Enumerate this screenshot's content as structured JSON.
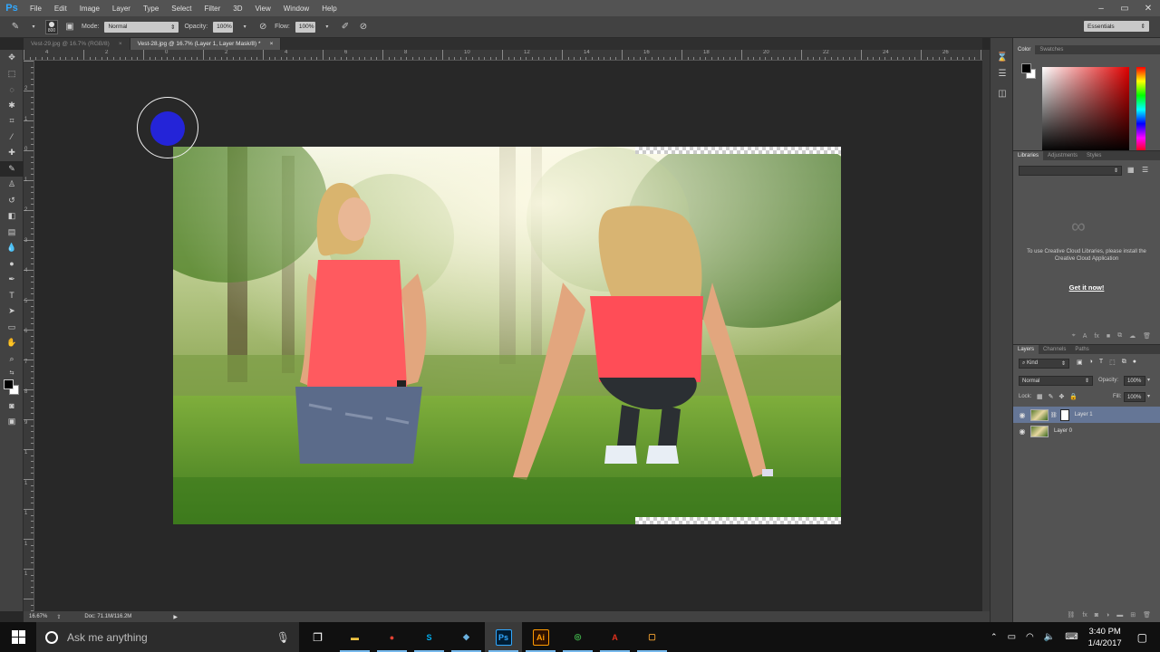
{
  "app": {
    "logo": "Ps"
  },
  "menu": [
    "File",
    "Edit",
    "Image",
    "Layer",
    "Type",
    "Select",
    "Filter",
    "3D",
    "View",
    "Window",
    "Help"
  ],
  "options": {
    "brush_size": "800",
    "mode_label": "Mode:",
    "mode_value": "Normal",
    "opacity_label": "Opacity:",
    "opacity_value": "100%",
    "flow_label": "Flow:",
    "flow_value": "100%",
    "workspace": "Essentials"
  },
  "tabs": [
    {
      "label": "Vest-29.jpg @ 16.7% (RGB/8)",
      "active": false
    },
    {
      "label": "Vest-28.jpg @ 16.7% (Layer 1, Layer Mask/8) *",
      "active": true
    }
  ],
  "ruler": {
    "top_labels": [
      "4",
      "2",
      "0",
      "2",
      "4",
      "6",
      "8",
      "10",
      "12",
      "14",
      "16",
      "18",
      "20",
      "22",
      "24",
      "26"
    ],
    "left_labels": [
      "2",
      "1",
      "0",
      "1",
      "2",
      "3",
      "4",
      "5",
      "6",
      "7",
      "8",
      "9",
      "1",
      "1",
      "1",
      "1",
      "1"
    ]
  },
  "status": {
    "zoom": "16.67%",
    "doc": "Doc: 71.1M/116.2M"
  },
  "color_panel": {
    "tabs": [
      "Color",
      "Swatches"
    ],
    "foreground": "#000000",
    "background": "#ffffff"
  },
  "libraries_panel": {
    "tabs": [
      "Libraries",
      "Adjustments",
      "Styles"
    ],
    "message": "To use Creative Cloud Libraries, please install the Creative Cloud Application",
    "link": "Get it now!"
  },
  "layers_panel": {
    "tabs": [
      "Layers",
      "Channels",
      "Paths"
    ],
    "filter": "Kind",
    "blend_mode": "Normal",
    "opacity_label": "Opacity:",
    "opacity_value": "100%",
    "lock_label": "Lock:",
    "fill_label": "Fill:",
    "fill_value": "100%",
    "layers": [
      {
        "name": "Layer 1",
        "selected": true,
        "has_mask": true
      },
      {
        "name": "Layer 0",
        "selected": false,
        "has_mask": false
      }
    ]
  },
  "taskbar": {
    "search_placeholder": "Ask me anything",
    "time": "3:40 PM",
    "date": "1/4/2017",
    "apps": [
      {
        "name": "File Explorer",
        "glyph": "▬",
        "color": "#f4c542"
      },
      {
        "name": "Chrome",
        "glyph": "●",
        "color": "#e34133"
      },
      {
        "name": "Skype",
        "glyph": "S",
        "color": "#00aff0"
      },
      {
        "name": "App",
        "glyph": "◆",
        "color": "#6ab0de"
      },
      {
        "name": "Photoshop",
        "glyph": "Ps",
        "color": "#31a8ff"
      },
      {
        "name": "Illustrator",
        "glyph": "Ai",
        "color": "#ff9a00"
      },
      {
        "name": "Network",
        "glyph": "◎",
        "color": "#3fae49"
      },
      {
        "name": "Acrobat",
        "glyph": "A",
        "color": "#e2311d"
      },
      {
        "name": "Document",
        "glyph": "▢",
        "color": "#f0a030"
      }
    ]
  }
}
